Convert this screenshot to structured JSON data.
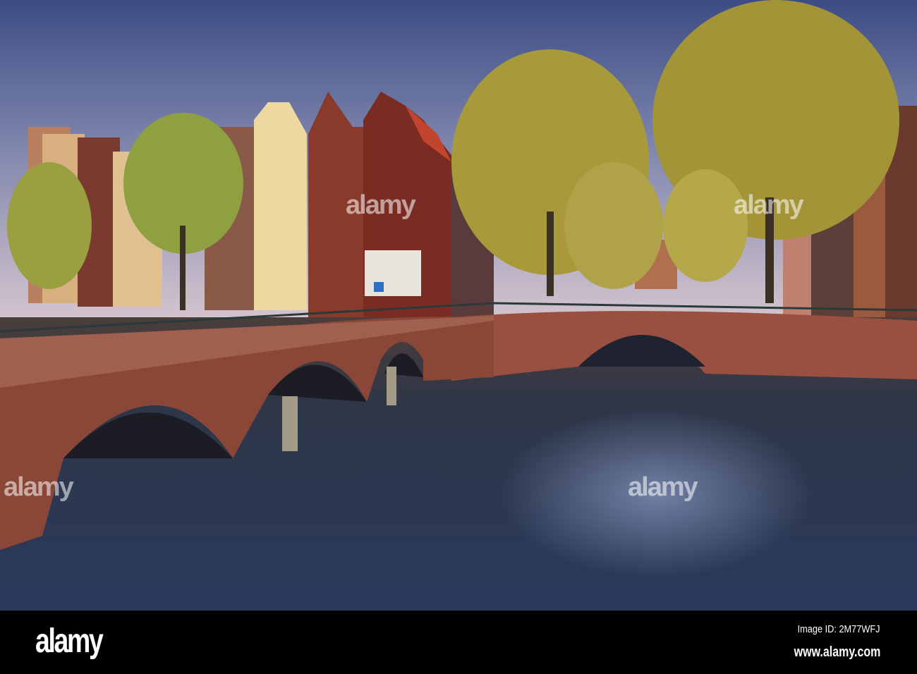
{
  "photo": {
    "subject": "Amsterdam canal with brick bridges and gabled houses",
    "colors": {
      "sky_top": "#3f4f86",
      "sky_low": "#c6b6c8",
      "water": "#2c3a52",
      "brick": "#8a4636",
      "foliage": "#b0a040"
    }
  },
  "watermark": {
    "text": "alamy"
  },
  "footer": {
    "logo": "alamy",
    "image_id": "Image ID: 2M77WFJ",
    "site": "www.alamy.com"
  }
}
